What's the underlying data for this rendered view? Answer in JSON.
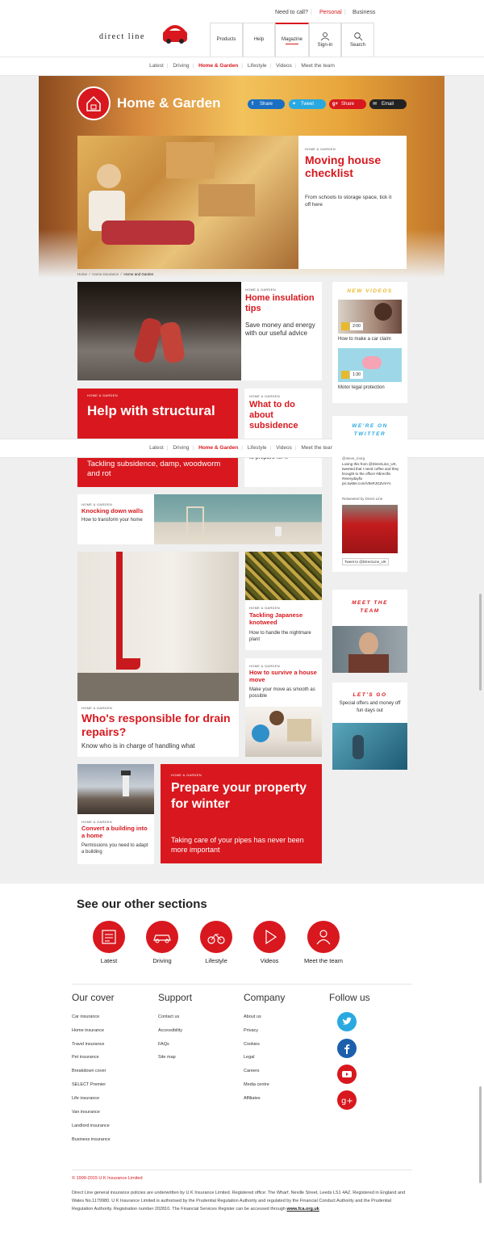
{
  "header": {
    "need_to_call": "Need to call?",
    "personal": "Personal",
    "business": "Business",
    "logo_text": "direct line",
    "nav": {
      "products": "Products",
      "help": "Help",
      "magazine": "Magazine",
      "signin": "Sign-in",
      "search": "Search"
    }
  },
  "subnav": [
    "Latest",
    "Driving",
    "Home & Garden",
    "Lifestyle",
    "Videos",
    "Meet the team"
  ],
  "hero": {
    "title": "Home & Garden",
    "share": {
      "facebook": "Share",
      "twitter": "Tweet",
      "gplus": "Share",
      "email": "Email"
    },
    "feature_kicker": "HOME & GARDEN",
    "feature_title": "Moving house checklist",
    "feature_desc": "From schools to storage space, tick it off here"
  },
  "breadcrumb": [
    "Home",
    "Home insurance",
    "Home and Garden"
  ],
  "articles": {
    "insulation": {
      "kicker": "HOME & GARDEN",
      "title": "Home insulation tips",
      "desc": "Save money and energy with our useful advice"
    },
    "structural": {
      "kicker": "HOME & GARDEN",
      "title": "Help with structural",
      "desc": "Tackling subsidence, damp, woodworm and rot"
    },
    "subsidence": {
      "kicker": "HOME & GARDEN",
      "title": "What to do about subsidence",
      "desc": "to prepare for it"
    },
    "knocking": {
      "kicker": "HOME & GARDEN",
      "title": "Knocking down walls",
      "desc": "How to transform your home"
    },
    "drain": {
      "kicker": "HOME & GARDEN",
      "title": "Who's responsible for drain repairs?",
      "desc": "Know who is in charge of handling what"
    },
    "knotweed": {
      "kicker": "HOME & GARDEN",
      "title": "Tackling Japanese knotweed",
      "desc": "How to handle the nightmare plant"
    },
    "housemove": {
      "kicker": "HOME & GARDEN",
      "title": "How to survive a house move",
      "desc": "Make your move as smooth as possible"
    },
    "convert": {
      "kicker": "HOME & GARDEN",
      "title": "Convert a building into a home",
      "desc": "Permissions you need to adapt a building"
    },
    "winter": {
      "kicker": "HOME & GARDEN",
      "title": "Prepare your property for winter",
      "desc": "Taking care of your pipes has never been more important"
    }
  },
  "sidebar": {
    "videos_title": "NEW VIDEOS",
    "video1": {
      "time": "2:00",
      "caption": "How to make a car claim"
    },
    "video2": {
      "time": "1:30",
      "caption": "Motor legal protection"
    },
    "twitter_title": "WE'RE ON TWITTER",
    "tweet_handle": "@steve_morg",
    "tweet_text": "Loving this from @DirectLine_UK, tweeted that I need coffee and they brought to the office! #directfix #everydayfix pic.twitter.com/V8sRJGZvmYs",
    "retweeted": "Retweeted by Direct Line",
    "tweet_to": "Tweet to @DirectLine_UK",
    "team_title": "MEET THE TEAM",
    "letsgo_title": "LET'S GO",
    "letsgo_desc": "Special offers and money off fun days out"
  },
  "other_sections": {
    "heading": "See our other sections",
    "items": [
      "Latest",
      "Driving",
      "Lifestyle",
      "Videos",
      "Meet the team"
    ]
  },
  "footer": {
    "cover": {
      "heading": "Our cover",
      "links": [
        "Car insurance",
        "Home insurance",
        "Travel insurance",
        "Pet insurance",
        "Breakdown cover",
        "SELECT Premier",
        "Life insurance",
        "Van insurance",
        "Landlord insurance",
        "Business insurance"
      ]
    },
    "support": {
      "heading": "Support",
      "links": [
        "Contact us",
        "Accessibility",
        "FAQs",
        "Site map"
      ]
    },
    "company": {
      "heading": "Company",
      "links": [
        "About us",
        "Privacy",
        "Cookies",
        "Legal",
        "Careers",
        "Media centre",
        "Affiliates"
      ]
    },
    "follow": {
      "heading": "Follow us"
    },
    "copyright": "© 1999-2015 U K Insurance Limited",
    "legal": "Direct Line general insurance policies are underwritten by U K Insurance Limited. Registered office: The Wharf, Neville Street, Leeds LS1 4AZ. Registered in England and Wales No.1179980. U K Insurance Limited is authorised by the Prudential Regulation Authority and regulated by the Financial Conduct Authority and the Prudential Regulation Authority. Registration number 202810. The Financial Services Register can be accessed through",
    "legal_link": "www.fca.org.uk"
  },
  "colors": {
    "brand_red": "#d8181e",
    "twitter_blue": "#1da1f2",
    "facebook_blue": "#3b5998"
  }
}
